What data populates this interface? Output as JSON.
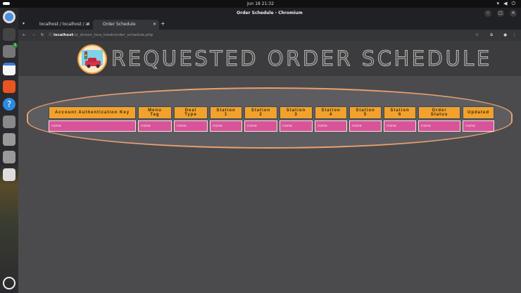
{
  "system": {
    "clock": "Jun 18  21:32",
    "tray_icons": [
      "wifi-icon",
      "volume-icon",
      "power-icon"
    ]
  },
  "dock": {
    "items": [
      "chromium",
      "terminal",
      "files",
      "text-editor",
      "app-center",
      "help",
      "settings",
      "unknown-app",
      "usb-drive",
      "trash"
    ],
    "files_badge": "1"
  },
  "window": {
    "title": "Order Schedule - Chromium"
  },
  "tabs": [
    {
      "label": "localhost / localhost / ai"
    },
    {
      "label": "Order Schedule",
      "active": true
    }
  ],
  "address": {
    "host": "localhost",
    "path": "/ai_driven_lora_kiosk/order_schedule.php"
  },
  "page": {
    "title": "REQUESTED ORDER SCHEDULE",
    "table": {
      "headers": [
        "Account Authentication Key",
        "Menu Tag",
        "Deal Type",
        "Station 1",
        "Station 2",
        "Station 3",
        "Station 4",
        "Station 5",
        "Station 6",
        "Order Status",
        "Updated"
      ],
      "rows": [
        [
          "none",
          "none",
          "none",
          "none",
          "none",
          "none",
          "none",
          "none",
          "none",
          "none",
          "none"
        ]
      ]
    }
  },
  "colors": {
    "header_bg": "#f2a22c",
    "cell_bg": "#d9539a",
    "panel_border": "#e8a070"
  }
}
